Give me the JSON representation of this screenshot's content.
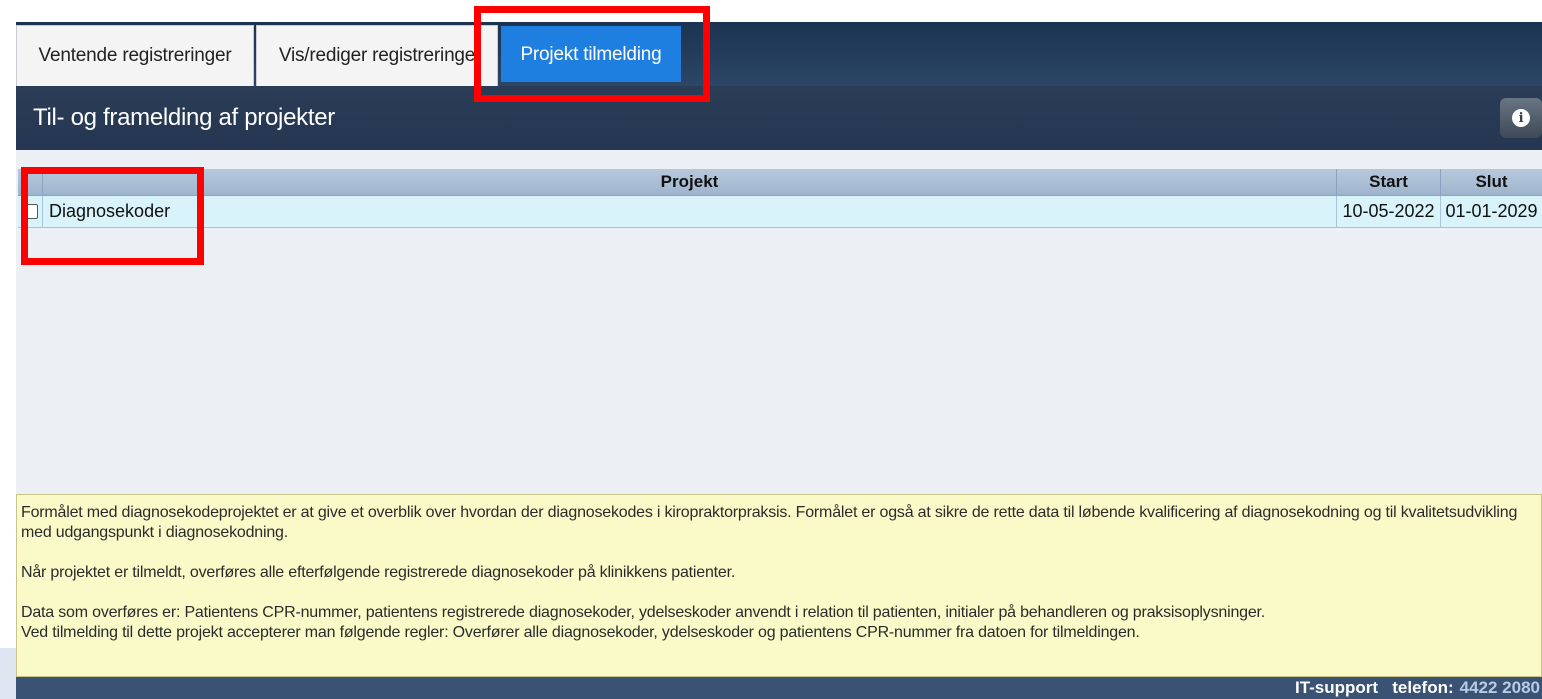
{
  "tabs": [
    {
      "label": "Ventende registreringer"
    },
    {
      "label": "Vis/rediger registreringe"
    },
    {
      "label": "Projekt tilmelding"
    }
  ],
  "header": {
    "title": "Til- og framelding af projekter",
    "info_icon": "info-icon"
  },
  "table": {
    "columns": [
      "Projekt",
      "Start",
      "Slut"
    ],
    "rows": [
      {
        "project": "Diagnosekoder",
        "start": "10-05-2022",
        "end": "01-01-2029",
        "checked": false
      }
    ]
  },
  "description": {
    "p1": "Formålet med diagnosekodeprojektet er at give et overblik over hvordan der diagnosekodes i kiropraktorpraksis. Formålet er også at sikre de rette data til løbende kvalificering af diagnosekodning og til kvalitetsudvikling med udgangspunkt i diagnosekodning.",
    "p2": "Når projektet er tilmeldt, overføres alle efterfølgende registrerede diagnosekoder på klinikkens patienter.",
    "p3": "Data som overføres er: Patientens CPR-nummer, patientens registrerede diagnosekoder, ydelseskoder anvendt i relation til patienten, initialer på behandleren og praksisoplysninger.",
    "p4": "Ved tilmelding til dette projekt accepterer man følgende regler: Overfører alle diagnosekoder, ydelseskoder og patientens CPR-nummer fra datoen for tilmeldingen."
  },
  "footer": {
    "label": "IT-support   telefon:",
    "phone": "4422 2080"
  },
  "colors": {
    "accent": "#1f7fe0",
    "highlight": "#ff0000",
    "row_bg": "#d9f3fb",
    "desc_bg": "#fafac9"
  }
}
